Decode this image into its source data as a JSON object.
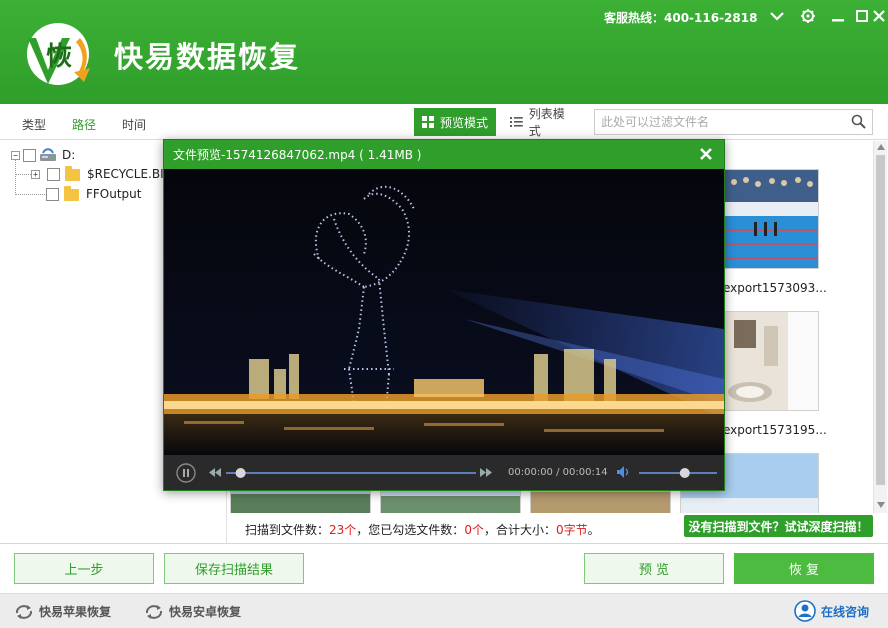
{
  "app": {
    "logo_char": "恢",
    "title": "快易数据恢复",
    "hotline": "客服热线：400-116-2818"
  },
  "toolbar": {
    "tabs": [
      {
        "label": "类型",
        "active": false
      },
      {
        "label": "路径",
        "active": true
      },
      {
        "label": "时间",
        "active": false
      }
    ],
    "preview_mode": "预览模式",
    "list_mode": "列表模式",
    "search_placeholder": "此处可以过滤文件名"
  },
  "tree": {
    "root": "D:",
    "children": [
      "$RECYCLE.BIN",
      "FFOutput"
    ]
  },
  "grid": {
    "items": [
      {
        "name": "export1573093..."
      },
      {
        "name": "export1573195..."
      }
    ]
  },
  "preview": {
    "title": "文件预览-1574126847062.mp4 ( 1.41MB )",
    "time": "00:00:00 / 00:00:14",
    "progress": 0.04,
    "volume": 0.6
  },
  "status": {
    "prefix": "扫描到文件数：",
    "scanned": "23个",
    "mid": "，您已勾选文件数：",
    "selected": "0个",
    "mid2": "，合计大小：",
    "size": "0字节",
    "suffix": "。"
  },
  "deep_scan": "没有扫描到文件？试试深度扫描！",
  "buttons": {
    "prev": "上一步",
    "save": "保存扫描结果",
    "preview": "预 览",
    "recover": "恢 复"
  },
  "footer": {
    "apple": "快易苹果恢复",
    "android": "快易安卓恢复",
    "online": "在线咨询"
  },
  "colors": {
    "brand_green": "#2f9e2b",
    "highlight_red": "#e21a1a"
  }
}
